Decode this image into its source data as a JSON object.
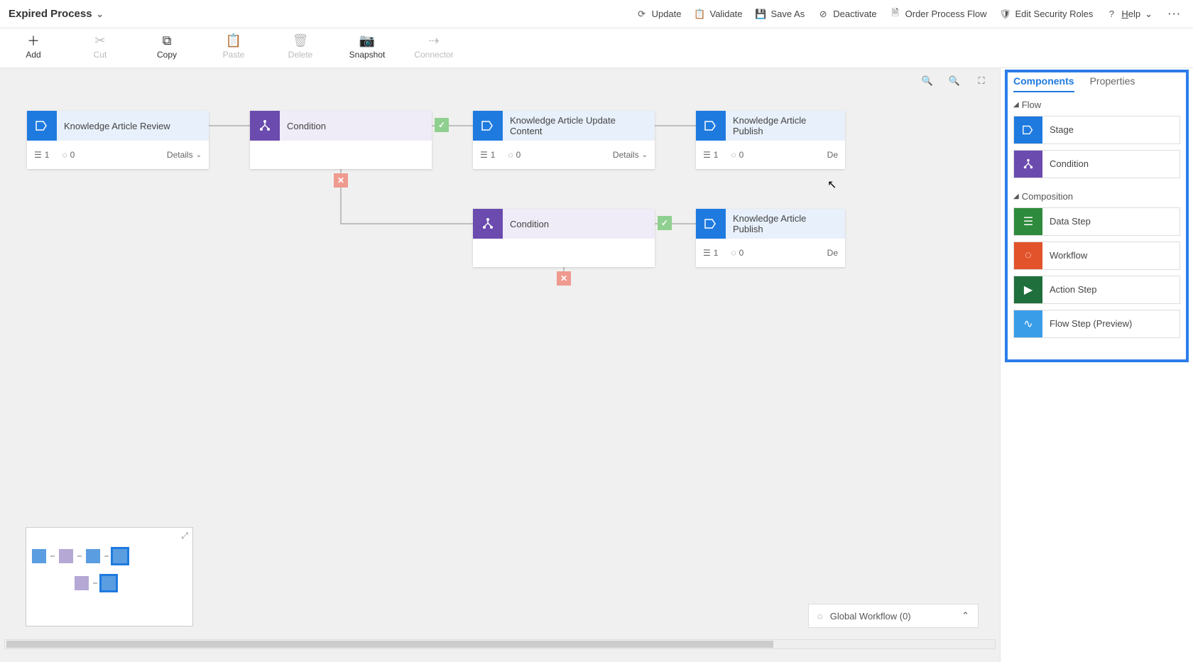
{
  "process_title": "Expired Process",
  "top_actions": {
    "update": "Update",
    "validate": "Validate",
    "save_as": "Save As",
    "deactivate": "Deactivate",
    "order": "Order Process Flow",
    "security": "Edit Security Roles",
    "help": "Help"
  },
  "ribbon": {
    "add": "Add",
    "cut": "Cut",
    "copy": "Copy",
    "paste": "Paste",
    "delete": "Delete",
    "snapshot": "Snapshot",
    "connector": "Connector"
  },
  "nodes": {
    "n1": {
      "title": "Knowledge Article Review",
      "steps": "1",
      "wf": "0",
      "details": "Details"
    },
    "n2": {
      "title": "Condition"
    },
    "n3": {
      "title": "Knowledge Article Update Content",
      "steps": "1",
      "wf": "0",
      "details": "Details"
    },
    "n4": {
      "title": "Knowledge Article Publish",
      "steps": "1",
      "wf": "0",
      "details": "De"
    },
    "n5": {
      "title": "Condition"
    },
    "n6": {
      "title": "Knowledge Article Publish",
      "steps": "1",
      "wf": "0",
      "details": "De"
    }
  },
  "global_workflow": "Global Workflow (0)",
  "sidepanel": {
    "tabs": {
      "components": "Components",
      "properties": "Properties"
    },
    "flow_section": "Flow",
    "composition_section": "Composition",
    "items": {
      "stage": "Stage",
      "condition": "Condition",
      "data_step": "Data Step",
      "workflow": "Workflow",
      "action_step": "Action Step",
      "flow_step": "Flow Step (Preview)"
    }
  }
}
